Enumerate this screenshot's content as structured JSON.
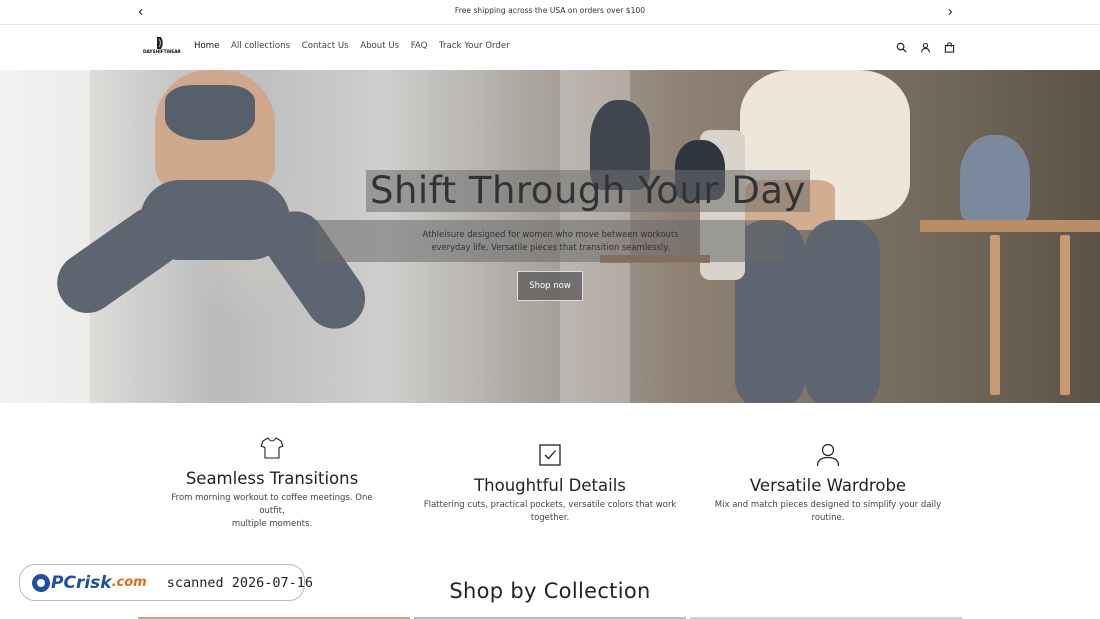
{
  "announcement": {
    "message": "Free shipping across the USA on orders over $100",
    "prev_icon": "chevron-left-icon",
    "next_icon": "chevron-right-icon"
  },
  "header": {
    "logo_text": "DAYSHIFTWEAR",
    "nav": [
      {
        "label": "Home",
        "active": true
      },
      {
        "label": "All collections",
        "active": false
      },
      {
        "label": "Contact Us",
        "active": false
      },
      {
        "label": "About Us",
        "active": false
      },
      {
        "label": "FAQ",
        "active": false
      },
      {
        "label": "Track Your Order",
        "active": false
      }
    ],
    "icons": [
      "search-icon",
      "account-icon",
      "cart-icon"
    ]
  },
  "hero": {
    "title": "Shift Through Your Day",
    "subtitle_line1": "Athleisure designed for women who move between workouts",
    "subtitle_line2": "everyday life. Versatile pieces that transition seamlessly.",
    "button_label": "Shop now"
  },
  "features": [
    {
      "icon": "tshirt-icon",
      "title": "Seamless Transitions",
      "text_line1": "From morning workout to coffee meetings. One outfit,",
      "text_line2": "multiple moments."
    },
    {
      "icon": "checkbox-icon",
      "title": "Thoughtful Details",
      "text_line1": "Flattering cuts, practical pockets, versatile colors that work together.",
      "text_line2": ""
    },
    {
      "icon": "person-icon",
      "title": "Versatile Wardrobe",
      "text_line1": "Mix and match pieces designed to simplify your daily routine.",
      "text_line2": ""
    }
  ],
  "collections": {
    "title": "Shop by Collection"
  },
  "watermark": {
    "brand": "PC",
    "brand_rest": "risk",
    "brand_tld": ".com",
    "scanned": "scanned 2026-07-16"
  },
  "colors": {
    "accent_blue": "#1e4fa3",
    "accent_orange": "#e36a16",
    "text": "#121212"
  }
}
